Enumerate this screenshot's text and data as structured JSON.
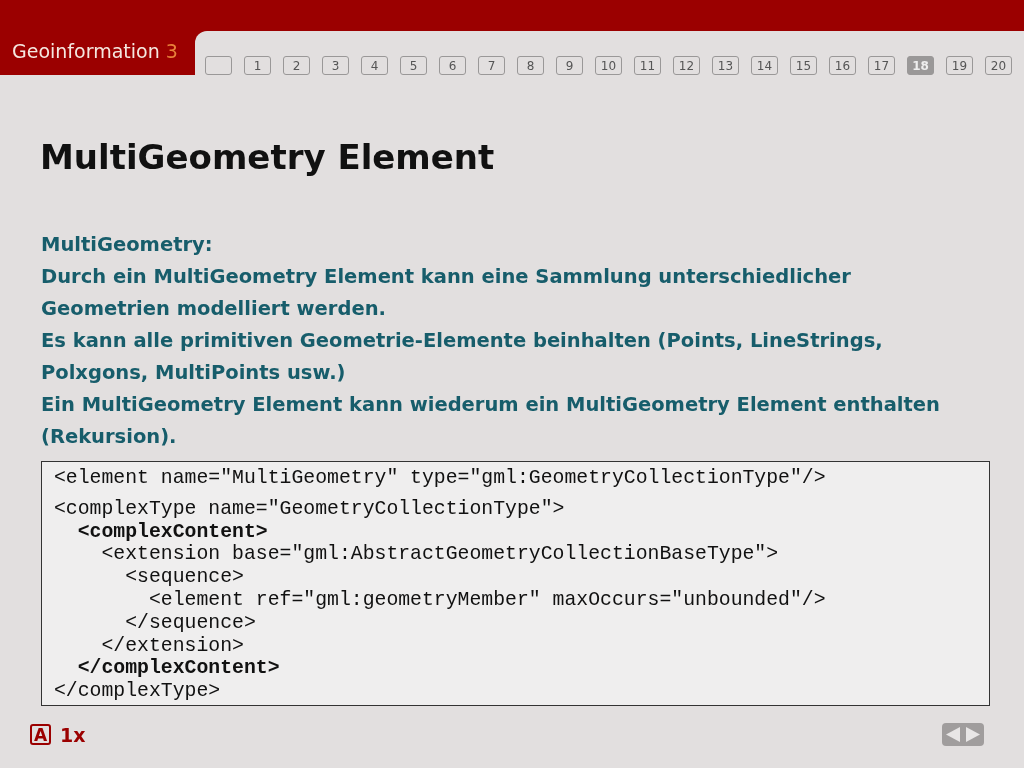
{
  "header": {
    "course": "Geoinformation",
    "course_number": "3"
  },
  "pages": [
    {
      "label": "1",
      "selected": false
    },
    {
      "label": "2",
      "selected": false
    },
    {
      "label": "3",
      "selected": false
    },
    {
      "label": "4",
      "selected": false
    },
    {
      "label": "5",
      "selected": false
    },
    {
      "label": "6",
      "selected": false
    },
    {
      "label": "7",
      "selected": false
    },
    {
      "label": "8",
      "selected": false
    },
    {
      "label": "9",
      "selected": false
    },
    {
      "label": "10",
      "selected": false
    },
    {
      "label": "11",
      "selected": false
    },
    {
      "label": "12",
      "selected": false
    },
    {
      "label": "13",
      "selected": false
    },
    {
      "label": "14",
      "selected": false
    },
    {
      "label": "15",
      "selected": false
    },
    {
      "label": "16",
      "selected": false
    },
    {
      "label": "17",
      "selected": false
    },
    {
      "label": "18",
      "selected": true
    },
    {
      "label": "19",
      "selected": false
    },
    {
      "label": "20",
      "selected": false
    }
  ],
  "title": "MultiGeometry Element",
  "paragraphs": [
    "MultiGeometry:",
    "Durch ein MultiGeometry Element kann eine Sammlung unterschiedlicher Geometrien modelliert werden.",
    "Es kann alle primitiven Geometrie-Elemente beinhalten (Points, LineStrings, Polxgons, MultiPoints usw.)",
    "Ein MultiGeometry Element kann wiederum ein MultiGeometry Element enthalten (Rekursion)."
  ],
  "code_groups": [
    {
      "lines": [
        {
          "text": "<element name=\"MultiGeometry\" type=\"gml:GeometryCollectionType\"/>",
          "bold": false
        }
      ]
    },
    {
      "lines": [
        {
          "text": "<complexType name=\"GeometryCollectionType\">",
          "bold": false
        },
        {
          "text": "  <complexContent>",
          "bold": true
        },
        {
          "text": "    <extension base=\"gml:AbstractGeometryCollectionBaseType\">",
          "bold": false
        },
        {
          "text": "      <sequence>",
          "bold": false
        },
        {
          "text": "        <element ref=\"gml:geometryMember\" maxOccurs=\"unbounded\"/>",
          "bold": false
        },
        {
          "text": "      </sequence>",
          "bold": false
        },
        {
          "text": "    </extension>",
          "bold": false
        },
        {
          "text": "  </complexContent>",
          "bold": true
        },
        {
          "text": "</complexType>",
          "bold": false
        }
      ]
    }
  ],
  "footer": {
    "icon_letter": "A",
    "zoom": "1x"
  }
}
